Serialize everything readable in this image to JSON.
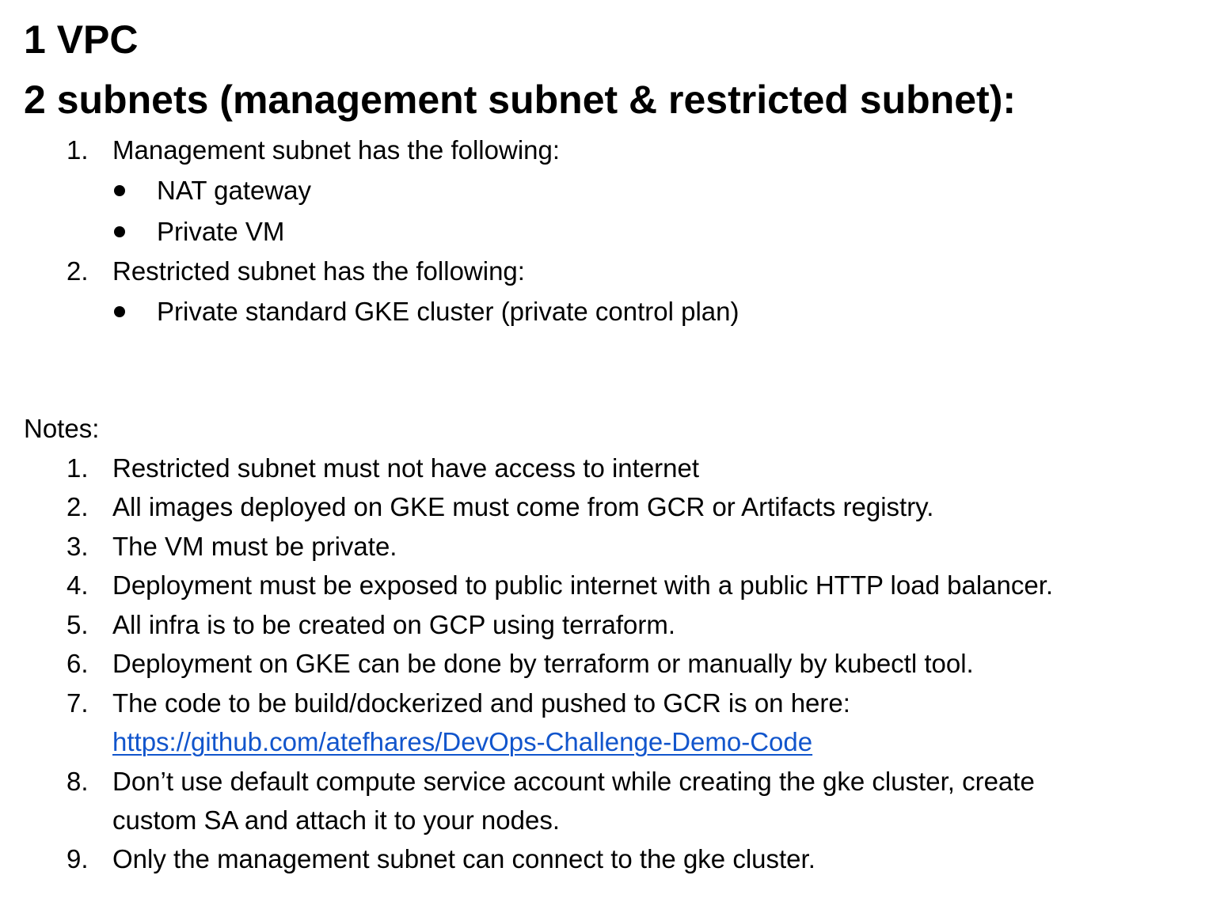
{
  "heading1": "1 VPC",
  "heading2": "2 subnets (management subnet & restricted subnet):",
  "subnets": [
    {
      "number": "1.",
      "text": "Management subnet has the following:",
      "bullets": [
        "NAT gateway",
        "Private VM"
      ]
    },
    {
      "number": "2.",
      "text": "Restricted subnet has the following:",
      "bullets": [
        "Private standard GKE cluster (private control plan)"
      ]
    }
  ],
  "notes_label": "Notes:",
  "notes": [
    {
      "number": "1.",
      "text": "Restricted subnet must not have access to internet"
    },
    {
      "number": "2.",
      "text": "All images deployed on GKE must come from GCR or Artifacts registry."
    },
    {
      "number": "3.",
      "text": "The VM must be private."
    },
    {
      "number": "4.",
      "text": "Deployment must be exposed to public internet with a public HTTP load balancer."
    },
    {
      "number": "5.",
      "text": "All infra is to be created on GCP using terraform."
    },
    {
      "number": "6.",
      "text": "Deployment on GKE can be done by terraform or manually by kubectl tool."
    },
    {
      "number": "7.",
      "text": "The code to be build/dockerized and pushed to GCR is on here:",
      "link": "https://github.com/atefhares/DevOps-Challenge-Demo-Code"
    },
    {
      "number": "8.",
      "text": "Don’t use default compute service account while creating the gke cluster, create",
      "continuation": "custom SA and attach it to your nodes."
    },
    {
      "number": "9.",
      "text": "Only the management subnet can connect to the gke cluster."
    }
  ],
  "colors": {
    "text": "#000000",
    "link": "#1155cc",
    "background": "#ffffff"
  }
}
